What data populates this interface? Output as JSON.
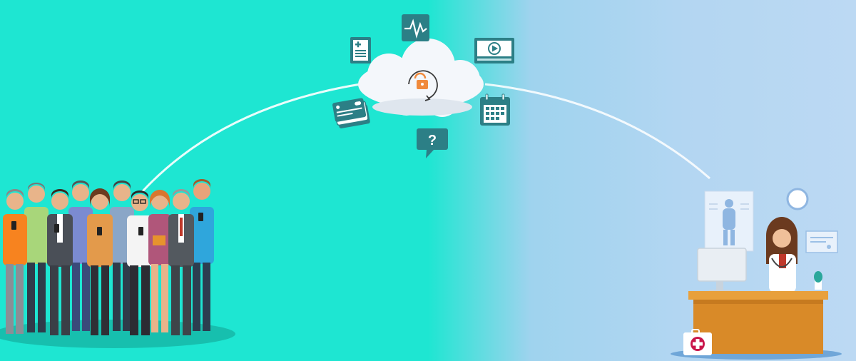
{
  "scene": {
    "colors": {
      "background_left": "#1ee6d2",
      "background_right": "#bcd9f3",
      "icon_tile": "#2c7f86",
      "cloud": "#f4f7fb",
      "lock_accent": "#f08a3c",
      "desk": "#e8a03c"
    },
    "cloud_icons": [
      "prescription-document-icon",
      "heart-monitor-icon",
      "video-player-icon",
      "calendar-icon",
      "help-question-icon",
      "insurance-card-icon"
    ],
    "question_glyph": "?"
  }
}
